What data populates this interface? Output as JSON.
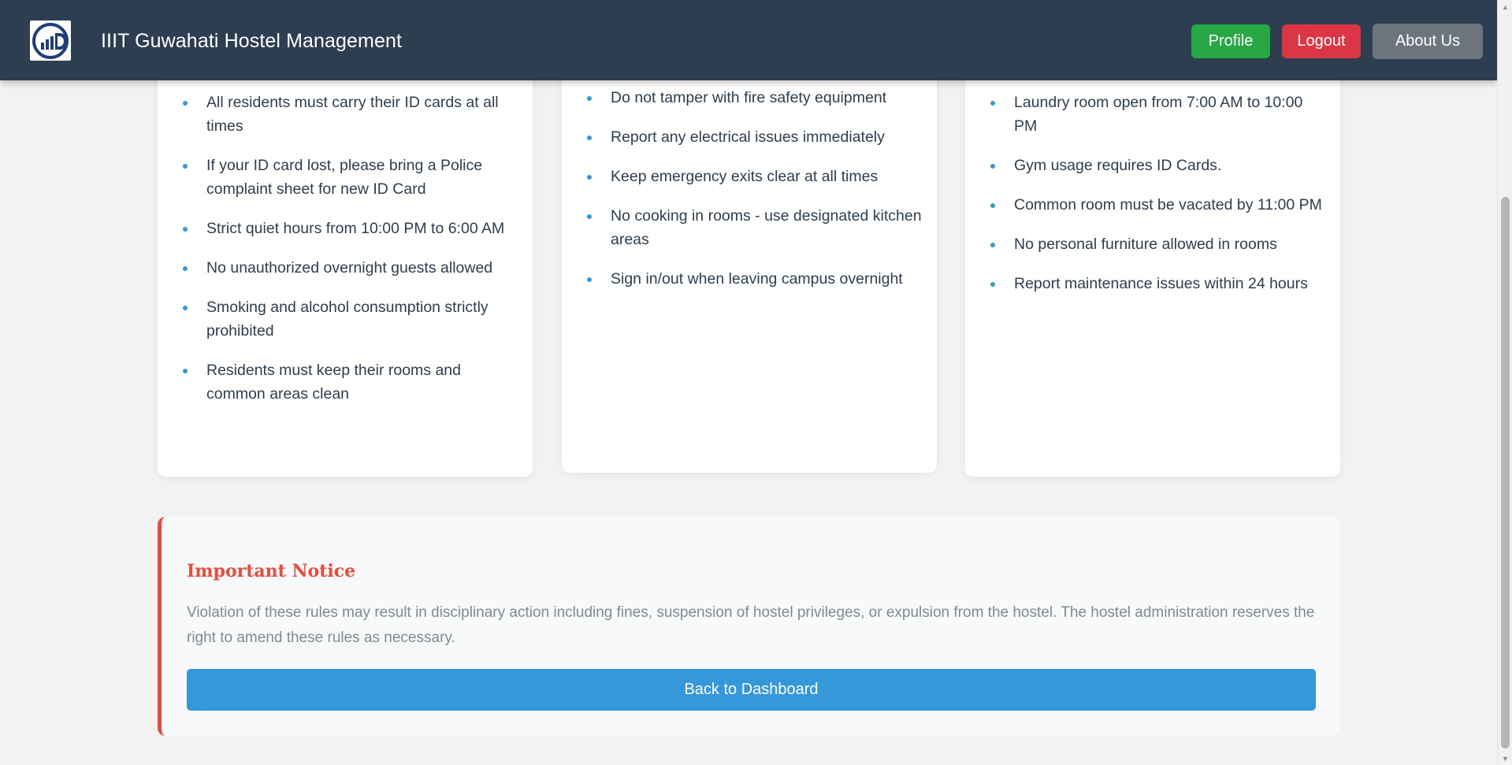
{
  "header": {
    "brand": "IIIT Guwahati Hostel Management",
    "logo_icon": "iiitg-logo-icon",
    "buttons": {
      "profile": "Profile",
      "logout": "Logout",
      "about": "About Us"
    },
    "colors": {
      "background": "#2c3e50",
      "profile": "#28a745",
      "logout": "#dc3545",
      "about": "#6c757d"
    }
  },
  "rule_cards": [
    {
      "items": [
        "All residents must carry their ID cards at all times",
        "If your ID card lost, please bring a Police complaint sheet for new ID Card",
        "Strict quiet hours from 10:00 PM to 6:00 AM",
        "No unauthorized overnight guests allowed",
        "Smoking and alcohol consumption strictly prohibited",
        "Residents must keep their rooms and common areas clean"
      ]
    },
    {
      "items": [
        "Do not tamper with fire safety equipment",
        "Report any electrical issues immediately",
        "Keep emergency exits clear at all times",
        "No cooking in rooms - use designated kitchen areas",
        "Sign in/out when leaving campus overnight"
      ]
    },
    {
      "items": [
        "Laundry room open from 7:00 AM to 10:00 PM",
        "Gym usage requires ID Cards.",
        "Common room must be vacated by 11:00 PM",
        "No personal furniture allowed in rooms",
        "Report maintenance issues within 24 hours"
      ]
    }
  ],
  "notice": {
    "title": "Important Notice",
    "text": "Violation of these rules may result in disciplinary action including fines, suspension of hostel privileges, or expulsion from the hostel. The hostel administration reserves the right to amend these rules as necessary.",
    "button": "Back to Dashboard",
    "accent_color": "#e74c3c",
    "button_color": "#3498db"
  }
}
